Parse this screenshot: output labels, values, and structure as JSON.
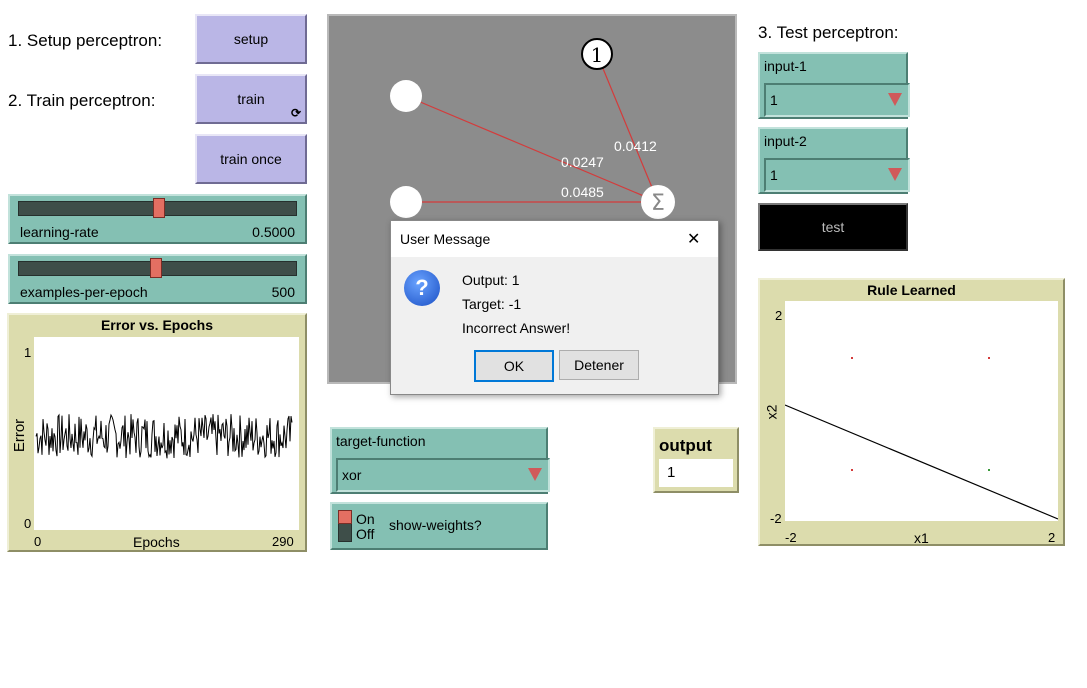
{
  "labels": {
    "setup_step": "1. Setup perceptron:",
    "train_step": "2. Train perceptron:",
    "test_step": "3. Test perceptron:"
  },
  "buttons": {
    "setup": "setup",
    "train": "train",
    "train_once": "train once",
    "test": "test"
  },
  "sliders": {
    "learning_rate": {
      "label": "learning-rate",
      "value": "0.5000",
      "fraction": 0.5
    },
    "examples_per_epoch": {
      "label": "examples-per-epoch",
      "value": "500",
      "fraction": 0.49
    }
  },
  "error_plot": {
    "title": "Error vs. Epochs",
    "xlabel": "Epochs",
    "ylabel": "Error",
    "xmin": "0",
    "xmax": "290",
    "ymin": "0",
    "ymax": "1"
  },
  "network": {
    "bias_label": "1",
    "sum_symbol": "Σ",
    "weights": [
      "0.0412",
      "0.0247",
      "0.0485"
    ]
  },
  "choosers": {
    "input1": {
      "title": "input-1",
      "value": "1"
    },
    "input2": {
      "title": "input-2",
      "value": "1"
    },
    "target_function": {
      "title": "target-function",
      "value": "xor"
    }
  },
  "switch": {
    "on_label": "On",
    "off_label": "Off",
    "label": "show-weights?"
  },
  "output_monitor": {
    "title": "output",
    "value": "1"
  },
  "rule_plot": {
    "title": "Rule Learned",
    "xlabel": "x1",
    "ylabel": "x2",
    "xmin": "-2",
    "xmax": "2",
    "ymin": "-2",
    "ymax": "2"
  },
  "dialog": {
    "title": "User Message",
    "close_glyph": "✕",
    "icon_glyph": "?",
    "lines": [
      "Output: 1",
      "Target: -1",
      "Incorrect Answer!"
    ],
    "ok": "OK",
    "stop": "Detener"
  },
  "colors": {
    "button": "#bab6e6",
    "widget": "#84c0b3",
    "plot": "#dcdcad",
    "view_bg": "#8c8c8c",
    "link": "#d43b3b"
  }
}
